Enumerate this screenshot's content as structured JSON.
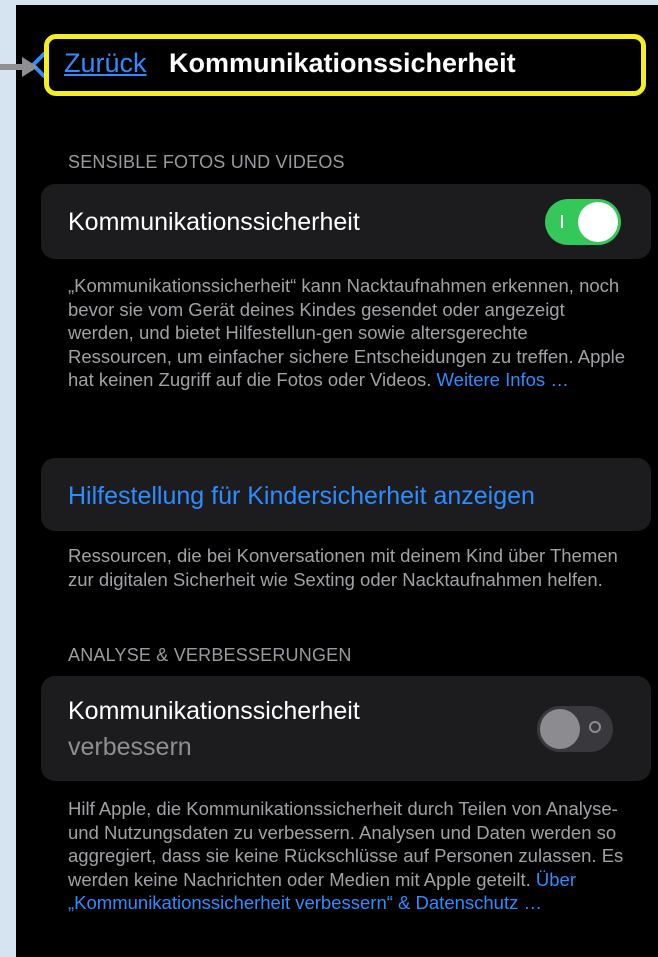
{
  "nav": {
    "back_label": "Zurück",
    "title": "Kommunikationssicherheit"
  },
  "section1": {
    "header": "SENSIBLE FOTOS UND VIDEOS",
    "toggle_label": "Kommunikationssicherheit",
    "toggle_on": true,
    "footer_text": "„Kommunikationssicherheit“ kann Nacktaufnahmen erkennen, noch bevor sie vom Gerät deines Kindes gesendet oder angezeigt werden, und bietet Hilfestellun-gen sowie altersgerechte Ressourcen, um einfacher sichere Entscheidungen zu treffen. Apple hat keinen Zugriff auf die Fotos oder Videos.",
    "footer_link": "Weitere Infos …"
  },
  "section2": {
    "action_label": "Hilfestellung für Kindersicherheit anzeigen",
    "footer_text": "Ressourcen, die bei Konversationen mit deinem Kind über Themen zur digitalen Sicherheit wie Sexting oder Nacktaufnahmen helfen."
  },
  "section3": {
    "header": "ANALYSE & VERBESSERUNGEN",
    "toggle_label_line1": "Kommunikationssicherheit",
    "toggle_label_line2": "verbessern",
    "toggle_on": false,
    "footer_text": "Hilf Apple, die Kommunikationssicherheit durch Teilen von Analyse- und Nutzungsdaten zu verbessern. Analysen und Daten werden so aggregiert, dass sie keine Rückschlüsse auf Personen zulassen. Es werden keine Nachrichten oder Medien mit Apple geteilt.",
    "footer_link_line1": "Über",
    "footer_link_line2": "„Kommunikationssicherheit verbessern“ & Datenschutz …"
  },
  "colors": {
    "accent": "#2f8cff",
    "toggle_on": "#34c759",
    "highlight": "#f5ee22",
    "card": "#1c1c1e"
  },
  "icons": [
    "back-chevron-icon",
    "pointer-arrow-icon"
  ]
}
